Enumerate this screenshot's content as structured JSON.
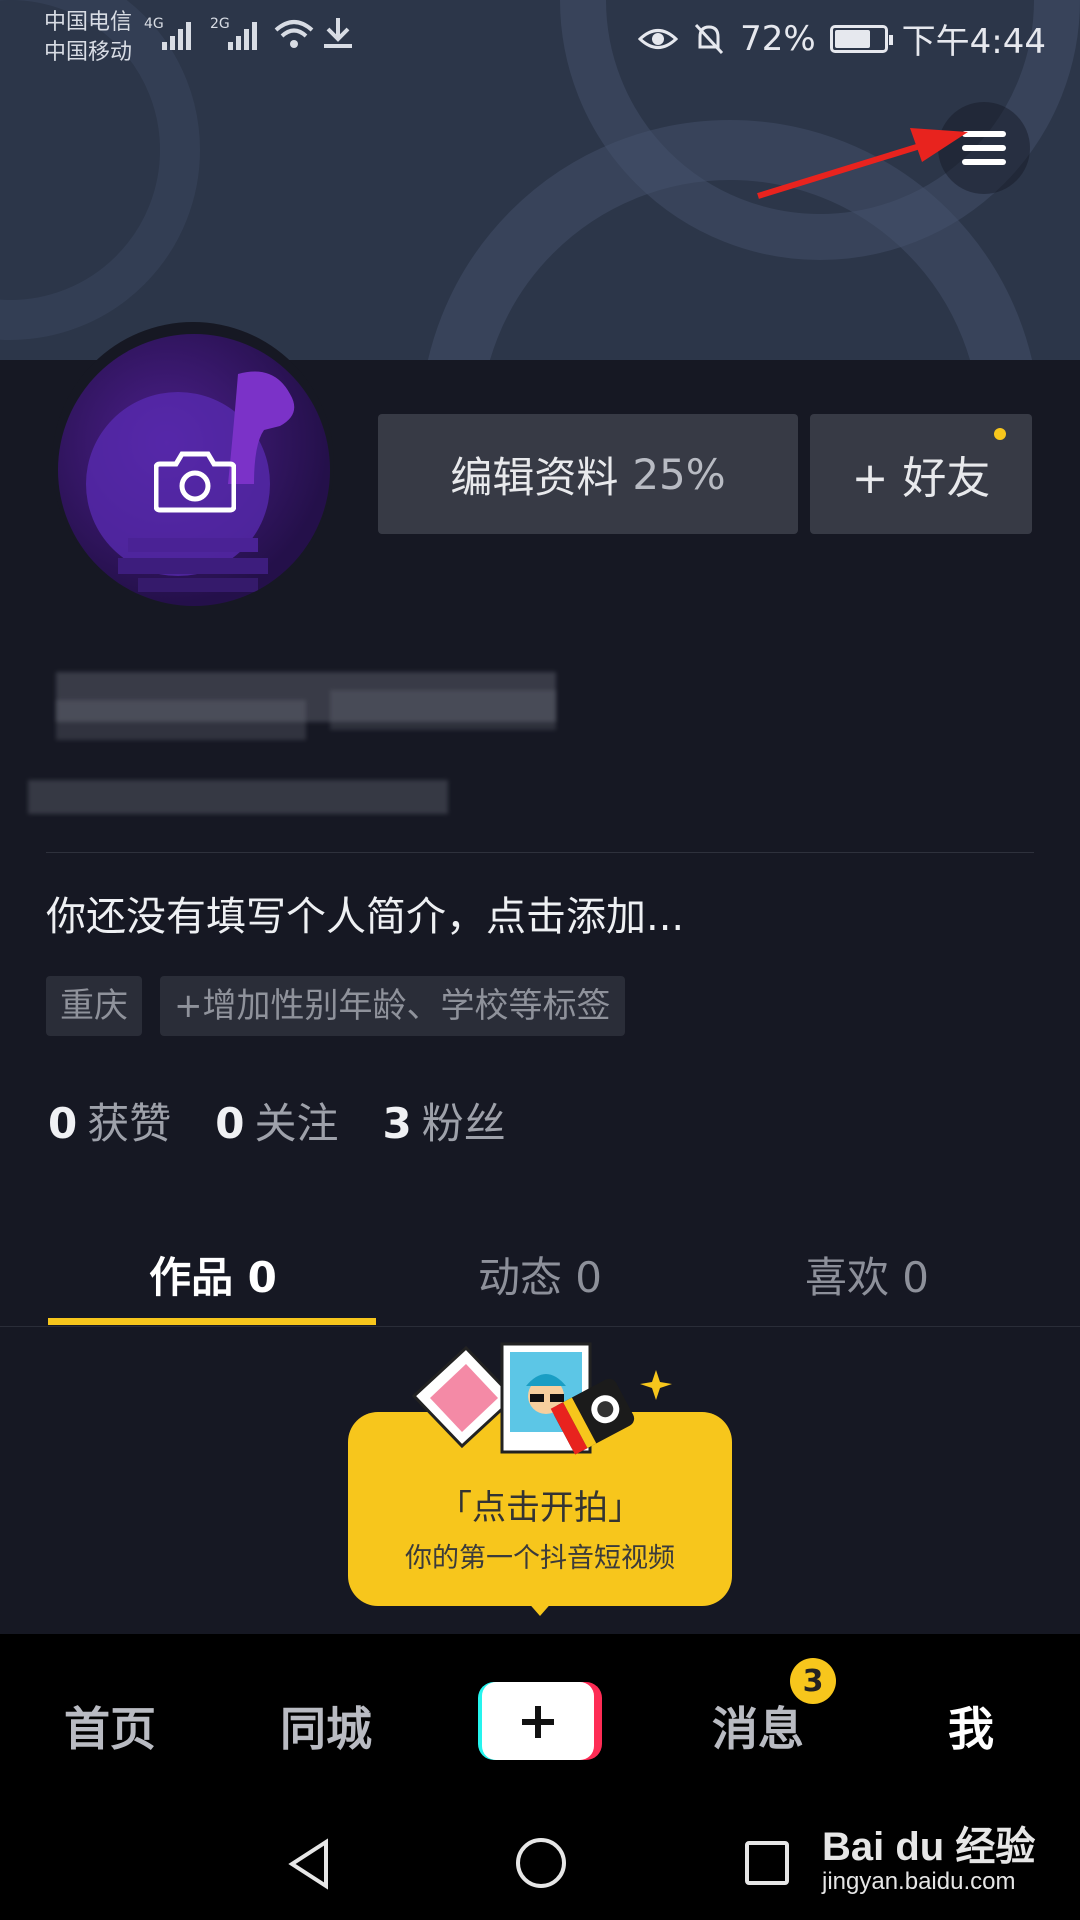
{
  "status_bar": {
    "carrier_1": "中国电信",
    "carrier_2": "中国移动",
    "net_1": "4G",
    "net_2": "2G",
    "battery": "72%",
    "battery_level": 0.72,
    "time": "下午4:44"
  },
  "header": {
    "menu_icon": "hamburger-menu-icon"
  },
  "profile": {
    "avatar_icon": "camera-icon",
    "edit_label": "编辑资料",
    "edit_progress": "25%",
    "add_friend_label": "+ 好友",
    "bio_placeholder": "你还没有填写个人简介，点击添加...",
    "tags": [
      "重庆",
      "+增加性别年龄、学校等标签"
    ],
    "stats": [
      {
        "count": "0",
        "label": "获赞"
      },
      {
        "count": "0",
        "label": "关注"
      },
      {
        "count": "3",
        "label": "粉丝"
      }
    ]
  },
  "tabs": [
    {
      "label": "作品 0",
      "active": true
    },
    {
      "label": "动态 0",
      "active": false
    },
    {
      "label": "喜欢 0",
      "active": false
    }
  ],
  "shoot_prompt": {
    "title": "「点击开拍」",
    "subtitle": "你的第一个抖音短视频"
  },
  "bottom_nav": {
    "items": [
      {
        "label": "首页"
      },
      {
        "label": "同城"
      },
      {
        "label": "消息",
        "badge": "3"
      },
      {
        "label": "我",
        "active": true
      }
    ],
    "plus_icon": "plus-icon"
  },
  "watermark": {
    "brand": "Bai du 经验",
    "url": "jingyan.baidu.com"
  },
  "colors": {
    "accent": "#f7c61c",
    "background": "#161823",
    "button": "#373a45",
    "arrow": "#e8231e"
  }
}
